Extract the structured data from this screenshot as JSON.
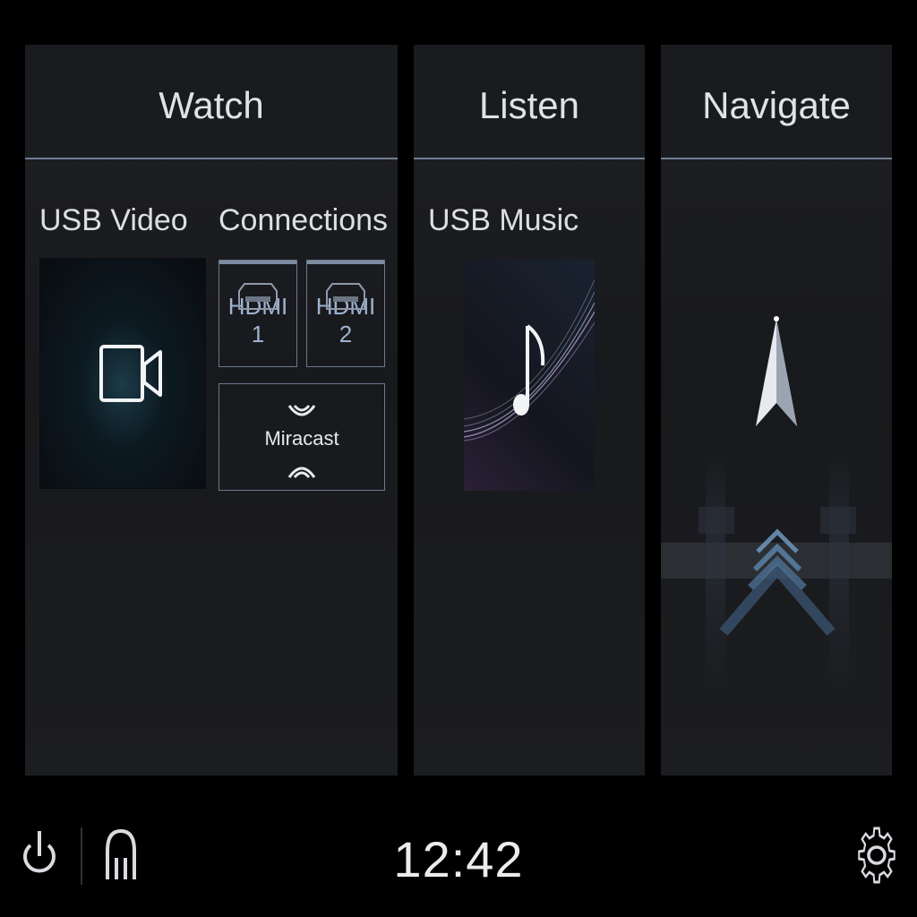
{
  "status_bar": {
    "clock": "12:42",
    "icons": [
      "power-icon",
      "usb-icon",
      "settings-icon"
    ]
  },
  "panels": [
    {
      "id": "watch",
      "footer_label": "Watch",
      "tiles": [
        {
          "label": "USB Video",
          "icon": "video-camera-icon"
        },
        {
          "label": "Connections",
          "items": [
            {
              "label": "Miracast",
              "icon": "wireless-icon"
            },
            {
              "label": "HDMI 1",
              "icon": "hdmi-port-icon"
            },
            {
              "label": "HDMI 2",
              "icon": "hdmi-port-icon"
            }
          ]
        }
      ]
    },
    {
      "id": "listen",
      "footer_label": "Listen",
      "tiles": [
        {
          "label": "USB Music",
          "icon": "music-note-icon"
        }
      ]
    },
    {
      "id": "navigate",
      "footer_label": "Navigate",
      "tiles": [
        {
          "label": "",
          "icon": "navigation-arrow-icon"
        }
      ]
    }
  ],
  "colors": {
    "background": "#000000",
    "panel": "#1c1d20",
    "accent_line": "#6f7e93",
    "hdmi_text": "#9db4d1"
  }
}
